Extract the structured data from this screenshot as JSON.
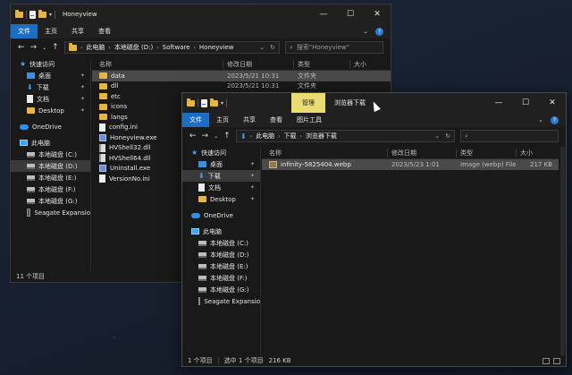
{
  "window1": {
    "title": "Honeyview",
    "tabs": [
      "文件",
      "主页",
      "共享",
      "查看"
    ],
    "address": [
      "此电脑",
      "本地磁盘 (D:)",
      "Software",
      "Honeyview"
    ],
    "search_placeholder": "搜索\"Honeyview\"",
    "columns": {
      "name": "名称",
      "date": "修改日期",
      "type": "类型",
      "size": "大小"
    },
    "files": [
      {
        "name": "data",
        "date": "2023/5/21 10:31",
        "type": "文件夹",
        "icon": "folder-icon"
      },
      {
        "name": "dll",
        "date": "2023/5/21 10:31",
        "type": "文件夹",
        "icon": "folder-icon"
      },
      {
        "name": "etc",
        "date": "",
        "type": "",
        "icon": "folder-icon"
      },
      {
        "name": "icons",
        "date": "",
        "type": "",
        "icon": "folder-icon"
      },
      {
        "name": "langs",
        "date": "",
        "type": "",
        "icon": "folder-icon"
      },
      {
        "name": "config.ini",
        "date": "",
        "type": "",
        "icon": "ini-file-icon"
      },
      {
        "name": "Honeyview.exe",
        "date": "",
        "type": "",
        "icon": "exe-icon"
      },
      {
        "name": "HVShell32.dll",
        "date": "",
        "type": "",
        "icon": "dll-icon"
      },
      {
        "name": "HVShell64.dll",
        "date": "",
        "type": "",
        "icon": "dll-icon"
      },
      {
        "name": "Uninstall.exe",
        "date": "",
        "type": "",
        "icon": "exe-icon"
      },
      {
        "name": "VersionNo.ini",
        "date": "",
        "type": "",
        "icon": "ini-file-icon"
      }
    ],
    "status": "11 个项目"
  },
  "window2": {
    "title": "浏览器下载",
    "context_tab": "管理",
    "tabs": [
      "文件",
      "主页",
      "共享",
      "查看",
      "图片工具"
    ],
    "address": [
      "此电脑",
      "下载",
      "浏览器下载"
    ],
    "columns": {
      "name": "名称",
      "date": "修改日期",
      "type": "类型",
      "size": "大小"
    },
    "files": [
      {
        "name": "infinity-5825404.webp",
        "date": "2023/5/23 1:01",
        "type": "Image (webp) File",
        "size": "217 KB"
      }
    ],
    "status": {
      "count": "1 个项目",
      "selected": "选中 1 个项目",
      "size": "216 KB"
    }
  },
  "sidebar": {
    "quick_access": "快速访问",
    "quick_items": [
      {
        "label": "桌面",
        "icon": "desktop-icon"
      },
      {
        "label": "下载",
        "icon": "download-icon"
      },
      {
        "label": "文档",
        "icon": "documents-icon"
      },
      {
        "label": "Desktop",
        "icon": "folder-icon"
      }
    ],
    "onedrive": "OneDrive",
    "this_pc": "此电脑",
    "drives": [
      "本地磁盘 (C:)",
      "本地磁盘 (D:)",
      "本地磁盘 (E:)",
      "本地磁盘 (F:)",
      "本地磁盘 (G:)"
    ],
    "usb": "Seagate Expansio"
  }
}
